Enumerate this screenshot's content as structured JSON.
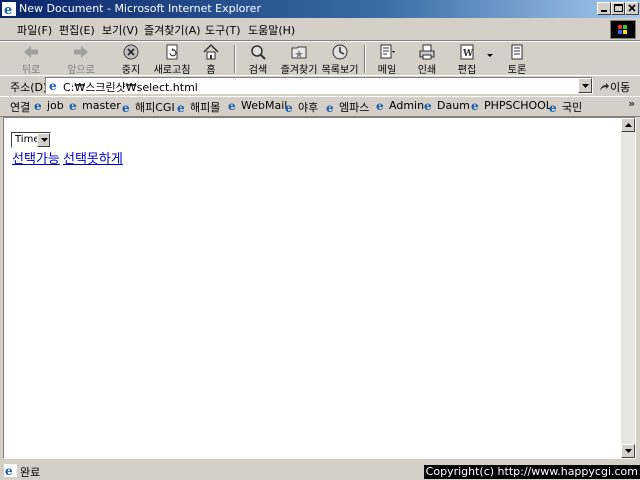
{
  "window": {
    "title": "New Document - Microsoft Internet Explorer"
  },
  "menu": {
    "items": [
      "파일(F)",
      "편집(E)",
      "보기(V)",
      "즐겨찾기(A)",
      "도구(T)",
      "도움말(H)"
    ]
  },
  "toolbar": {
    "back": "뒤로",
    "forward": "앞으로",
    "stop": "중지",
    "refresh": "새로고침",
    "home": "홈",
    "search": "검색",
    "favorites": "즐겨찾기",
    "history": "목록보기",
    "mail": "메일",
    "print": "인쇄",
    "edit": "편집",
    "discuss": "토론"
  },
  "address": {
    "label": "주소(D)",
    "value": "C:₩스크린샷₩select.html",
    "go": "이동"
  },
  "links": {
    "label": "연결",
    "items": [
      "job",
      "master",
      "해피CGI",
      "해피몰",
      "WebMail",
      "야후",
      "엠파스",
      "Admin",
      "Daum",
      "PHPSCHOOL",
      "국민"
    ]
  },
  "page": {
    "select_value": "Time",
    "link1": "선택가능",
    "link2": "선택못하게"
  },
  "status": {
    "text": "완료",
    "copyright": "Copyright(c) http://www.happycgi.com"
  },
  "colors": {
    "titlebar_start": "#0a246a",
    "titlebar_end": "#a6caf0",
    "link": "#0000cc",
    "chrome": "#d4d0c8"
  }
}
